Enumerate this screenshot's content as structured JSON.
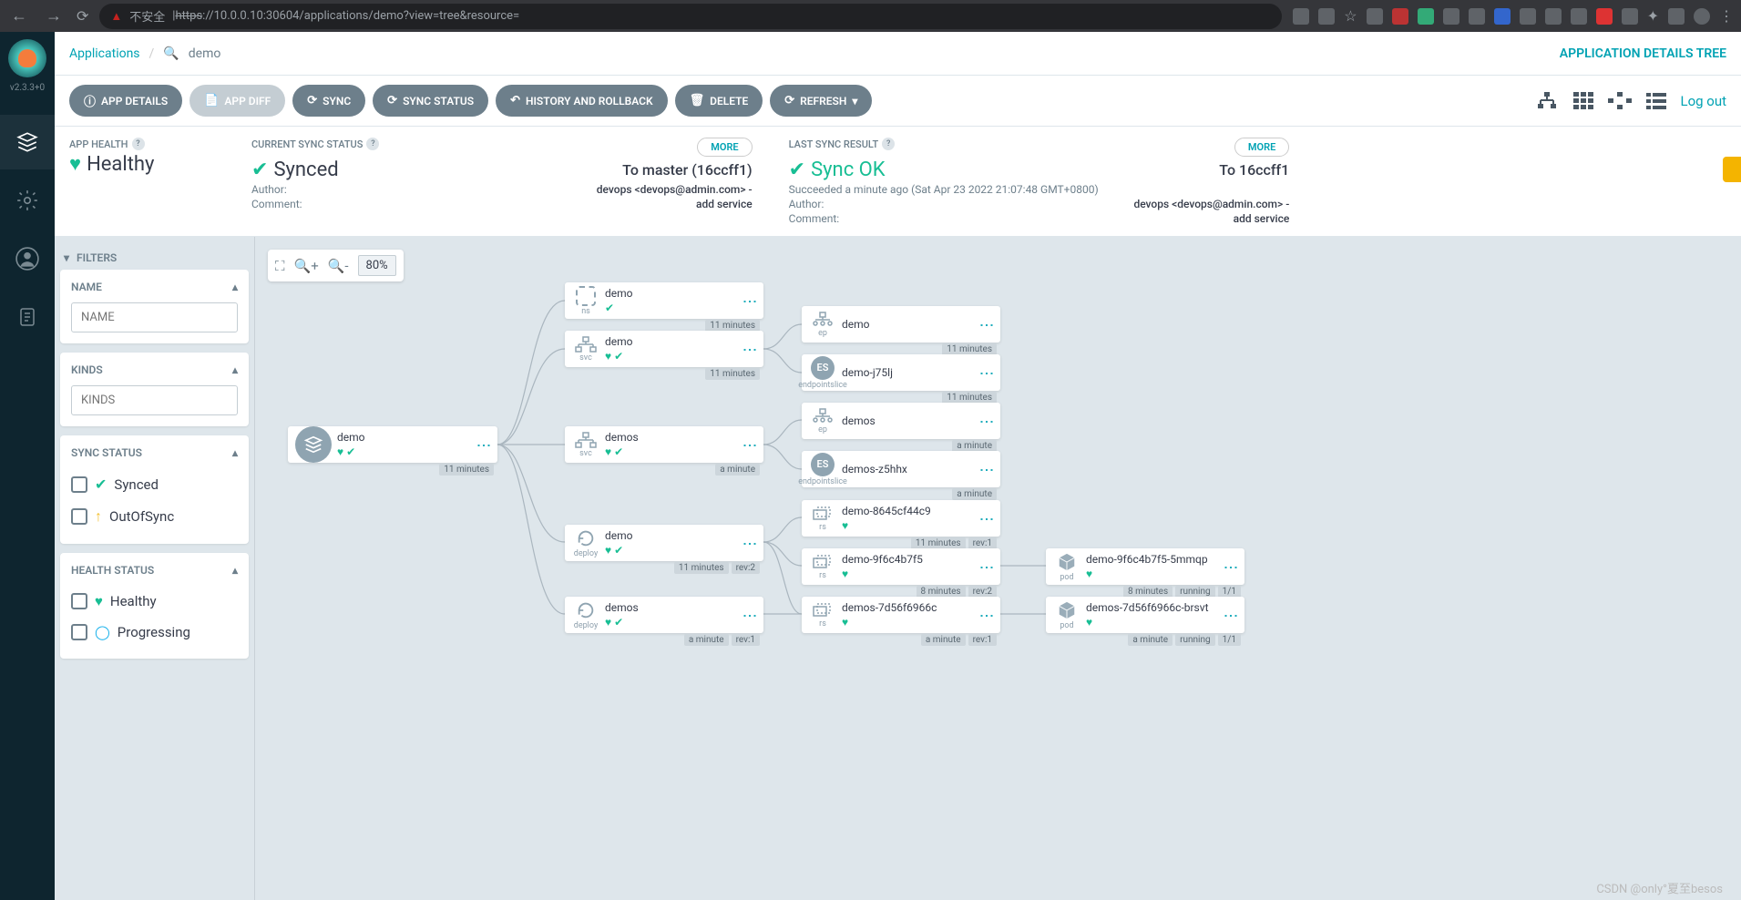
{
  "browser": {
    "insecure_label": "不安全",
    "url_proto": "https",
    "url_rest": "://10.0.0.10:30604/applications/demo?view=tree&resource="
  },
  "version": "v2.3.3+0",
  "breadcrumb": {
    "applications": "Applications",
    "app": "demo"
  },
  "page_title": "APPLICATION DETAILS TREE",
  "buttons": {
    "details": "APP DETAILS",
    "diff": "APP DIFF",
    "sync": "SYNC",
    "sync_status": "SYNC STATUS",
    "history": "HISTORY AND ROLLBACK",
    "delete": "DELETE",
    "refresh": "REFRESH"
  },
  "logout": "Log out",
  "health": {
    "label": "APP HEALTH",
    "value": "Healthy"
  },
  "sync_status": {
    "label": "CURRENT SYNC STATUS",
    "more": "MORE",
    "value": "Synced",
    "target": "To master (16ccff1)",
    "author_label": "Author:",
    "author": "devops <devops@admin.com> -",
    "comment_label": "Comment:",
    "comment": "add service"
  },
  "last_sync": {
    "label": "LAST SYNC RESULT",
    "more": "MORE",
    "value": "Sync OK",
    "target": "To 16ccff1",
    "succeeded": "Succeeded a minute ago (Sat Apr 23 2022 21:07:48 GMT+0800)",
    "author_label": "Author:",
    "author": "devops <devops@admin.com> -",
    "comment_label": "Comment:",
    "comment": "add service"
  },
  "filters": {
    "header": "FILTERS",
    "name_title": "NAME",
    "name_placeholder": "NAME",
    "kinds_title": "KINDS",
    "kinds_placeholder": "KINDS",
    "sync_status_title": "SYNC STATUS",
    "synced": "Synced",
    "outofsync": "OutOfSync",
    "health_status_title": "HEALTH STATUS",
    "healthy": "Healthy",
    "progressing": "Progressing"
  },
  "zoom": "80%",
  "watermark": "CSDN @only°夏至besos",
  "nodes": {
    "root_name": "demo",
    "root_age": "11 minutes",
    "ns_name": "demo",
    "ns_kind": "ns",
    "ns_age": "11 minutes",
    "svc1_name": "demo",
    "svc1_kind": "svc",
    "svc1_age": "11 minutes",
    "svc2_name": "demos",
    "svc2_kind": "svc",
    "svc2_age": "a minute",
    "deploy1_name": "demo",
    "deploy1_kind": "deploy",
    "deploy1_age": "11 minutes",
    "deploy1_rev": "rev:2",
    "deploy2_name": "demos",
    "deploy2_kind": "deploy",
    "deploy2_age": "a minute",
    "deploy2_rev": "rev:1",
    "ep1_name": "demo",
    "ep1_kind": "ep",
    "ep1_age": "11 minutes",
    "es1_name": "demo-j75lj",
    "es1_kind": "endpointslice",
    "es1_age": "11 minutes",
    "ep2_name": "demos",
    "ep2_kind": "ep",
    "ep2_age": "a minute",
    "es2_name": "demos-z5hhx",
    "es2_kind": "endpointslice",
    "es2_age": "a minute",
    "rs1_name": "demo-8645cf44c9",
    "rs1_kind": "rs",
    "rs1_age": "11 minutes",
    "rs1_rev": "rev:1",
    "rs2_name": "demo-9f6c4b7f5",
    "rs2_kind": "rs",
    "rs2_age": "8 minutes",
    "rs2_rev": "rev:2",
    "rs3_name": "demos-7d56f6966c",
    "rs3_kind": "rs",
    "rs3_age": "a minute",
    "rs3_rev": "rev:1",
    "pod1_name": "demo-9f6c4b7f5-5mmqp",
    "pod1_kind": "pod",
    "pod1_age": "8 minutes",
    "pod1_status": "running",
    "pod1_count": "1/1",
    "pod2_name": "demos-7d56f6966c-brsvt",
    "pod2_kind": "pod",
    "pod2_age": "a minute",
    "pod2_status": "running",
    "pod2_count": "1/1"
  }
}
